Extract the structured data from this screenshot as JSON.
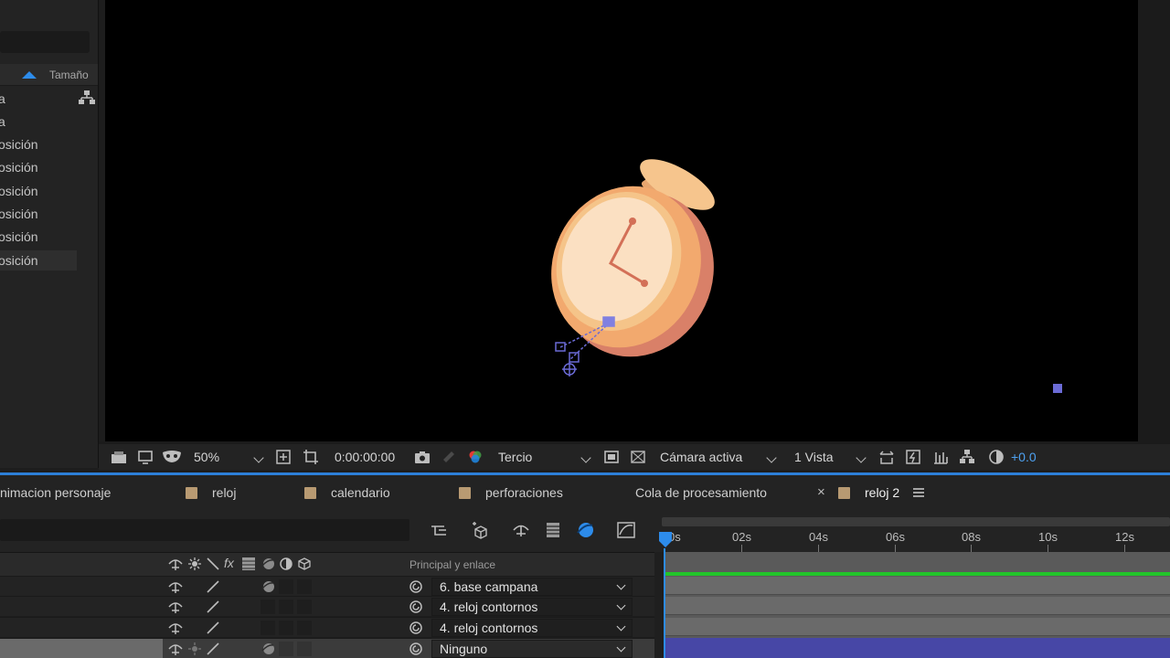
{
  "project_panel": {
    "size_column": "Tamaño",
    "rows": [
      "a",
      "a",
      "osición",
      "osición",
      "osición",
      "osición",
      "osición",
      "osición"
    ]
  },
  "viewer": {
    "zoom": "50%",
    "timecode": "0:00:00:00",
    "guide": "Tercio",
    "camera": "Cámara activa",
    "views": "1 Vista",
    "exposure": "+0.0"
  },
  "tabs": [
    {
      "label": "nimacion personaje",
      "swatch": false
    },
    {
      "label": "reloj",
      "swatch": true
    },
    {
      "label": "calendario",
      "swatch": true
    },
    {
      "label": "perforaciones",
      "swatch": true
    },
    {
      "label": "Cola de procesamiento",
      "swatch": false
    },
    {
      "label": "reloj 2",
      "swatch": true,
      "active": true
    }
  ],
  "ruler": {
    "labels": [
      "0s",
      "02s",
      "04s",
      "06s",
      "08s",
      "10s",
      "12s"
    ]
  },
  "layers": {
    "parent_header": "Principal y enlace",
    "rows": [
      {
        "parent": "6. base campana"
      },
      {
        "parent": "4. reloj contornos"
      },
      {
        "parent": "4. reloj contornos"
      },
      {
        "parent": "Ninguno"
      }
    ]
  },
  "colors": {
    "accent": "#2d8ceb",
    "track_green": "#22c52a",
    "track_selected": "#4747a6",
    "swatch": "#b89a72"
  }
}
